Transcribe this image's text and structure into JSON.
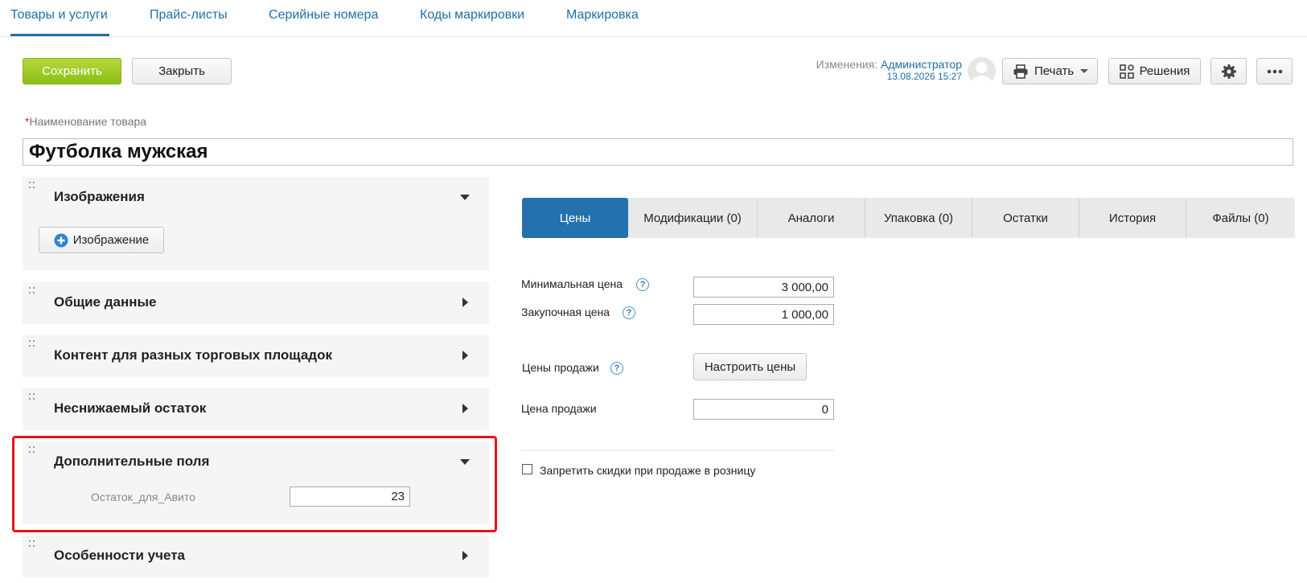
{
  "nav": {
    "tabs": [
      {
        "label": "Товары и услуги"
      },
      {
        "label": "Прайс-листы"
      },
      {
        "label": "Серийные номера"
      },
      {
        "label": "Коды маркировки"
      },
      {
        "label": "Маркировка"
      }
    ]
  },
  "toolbar": {
    "save_label": "Сохранить",
    "close_label": "Закрыть",
    "changes_label": "Изменения:",
    "changed_by": "Администратор",
    "changed_at": "13.08.2026 15:27",
    "print_label": "Печать",
    "solutions_label": "Решения"
  },
  "product": {
    "name_label": "Наименование товара",
    "required_mark": "*",
    "name_value": "Футболка мужская"
  },
  "panels": {
    "images": {
      "title": "Изображения",
      "add_image_label": "Изображение"
    },
    "general": {
      "title": "Общие данные"
    },
    "content": {
      "title": "Контент для разных торговых площадок"
    },
    "min_stock": {
      "title": "Неснижаемый остаток"
    },
    "extra_fields": {
      "title": "Дополнительные поля",
      "field_label": "Остаток_для_Авито",
      "field_value": "23"
    },
    "accounting": {
      "title": "Особенности учета"
    }
  },
  "tabs": [
    {
      "label": "Цены"
    },
    {
      "label": "Модификации (0)"
    },
    {
      "label": "Аналоги"
    },
    {
      "label": "Упаковка (0)"
    },
    {
      "label": "Остатки"
    },
    {
      "label": "История"
    },
    {
      "label": "Файлы (0)"
    }
  ],
  "prices": {
    "min_price_label": "Минимальная цена",
    "min_price_value": "3 000,00",
    "purchase_price_label": "Закупочная цена",
    "purchase_price_value": "1 000,00",
    "sale_prices_label": "Цены продажи",
    "configure_prices_label": "Настроить цены",
    "sale_price_label": "Цена продажи",
    "sale_price_value": "0",
    "no_discount_label": "Запретить скидки при продаже в розницу",
    "help_glyph": "?"
  },
  "colors": {
    "accent": "#2471ad",
    "save_green": "#9ac823",
    "highlight_red": "#e8121a"
  },
  "icons": [
    "plus-circle-icon",
    "printer-icon",
    "caret-down-icon",
    "grid-icon",
    "gear-icon",
    "more-icon",
    "drag-handle-icon",
    "chevron-down-icon",
    "chevron-right-icon",
    "help-icon",
    "checkbox-icon"
  ]
}
